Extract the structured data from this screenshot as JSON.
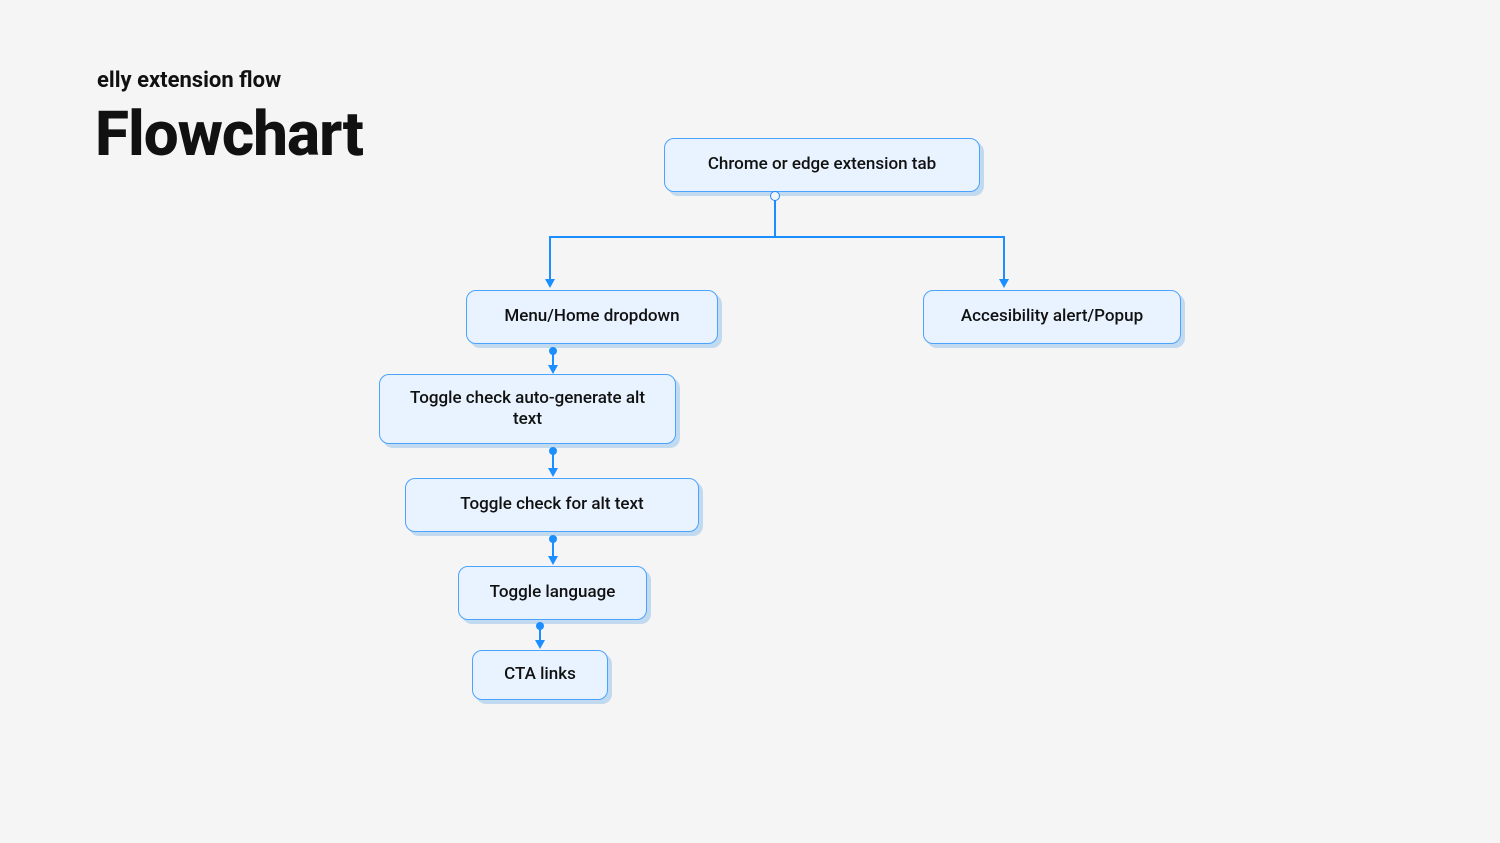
{
  "header": {
    "subtitle": "elly extension flow",
    "title": "Flowchart"
  },
  "nodes": {
    "root": {
      "label": "Chrome or edge extension tab"
    },
    "menu": {
      "label": "Menu/Home dropdown"
    },
    "alert": {
      "label": "Accesibility alert/Popup"
    },
    "toggle_auto": {
      "label": "Toggle check auto-generate alt text"
    },
    "toggle_alt": {
      "label": "Toggle check for alt text"
    },
    "toggle_lang": {
      "label": "Toggle language"
    },
    "cta": {
      "label": "CTA links"
    }
  }
}
